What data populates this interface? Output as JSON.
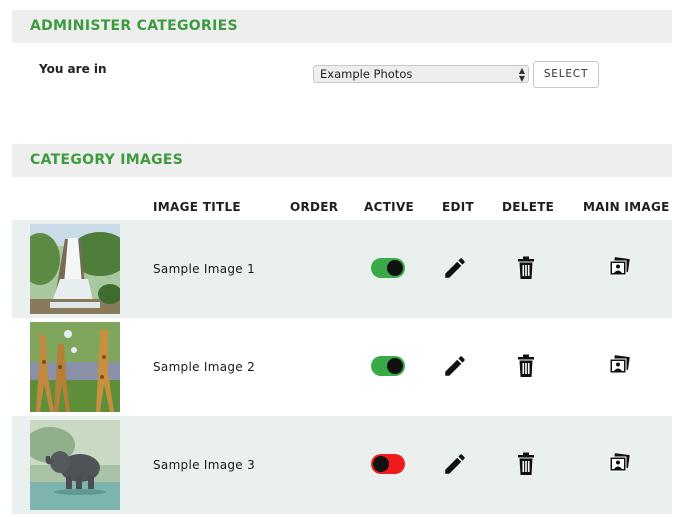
{
  "admin": {
    "header": "ADMINISTER CATEGORIES",
    "you_are_in_label": "You are in",
    "category_select": "Example Photos",
    "select_button": "SELECT"
  },
  "images": {
    "header": "CATEGORY IMAGES",
    "columns": {
      "title": "IMAGE TITLE",
      "order": "ORDER",
      "active": "ACTIVE",
      "edit": "EDIT",
      "delete": "DELETE",
      "main_image": "MAIN IMAGE"
    },
    "rows": [
      {
        "title": "Sample Image 1",
        "active": true,
        "thumbnail": "waterfall"
      },
      {
        "title": "Sample Image 2",
        "active": true,
        "thumbnail": "giraffes"
      },
      {
        "title": "Sample Image 3",
        "active": false,
        "thumbnail": "elephant"
      }
    ]
  },
  "colors": {
    "header_text": "#3e9a3e",
    "header_bg": "#eeeeee",
    "row_shade": "#eaf0ee",
    "toggle_on": "#3aaa48",
    "toggle_off": "#ee1c1c"
  },
  "icons": {
    "edit": "pencil-icon",
    "delete": "trash-icon",
    "main_image": "photos-icon",
    "select_arrows": "select-arrows-icon"
  }
}
